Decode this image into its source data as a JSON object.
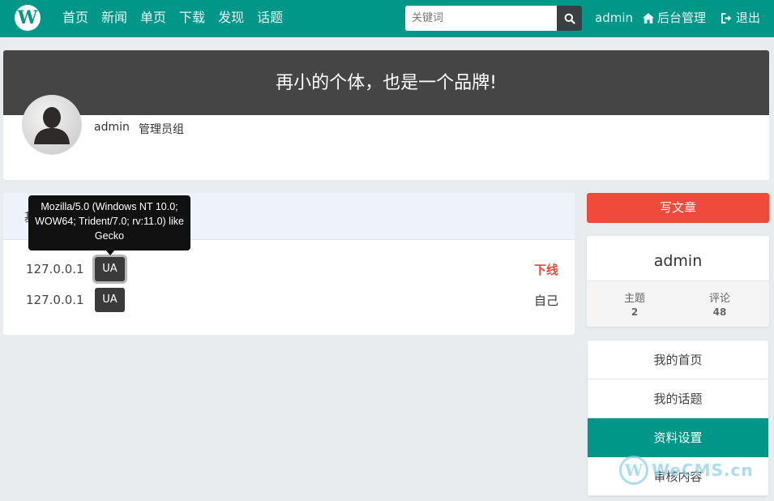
{
  "colors": {
    "brand": "#009688",
    "danger": "#f04a3a",
    "offline_text": "#e74c3c",
    "dark": "#454545"
  },
  "header": {
    "logo_letter": "W",
    "nav": [
      "首页",
      "新闻",
      "单页",
      "下载",
      "发现",
      "话题"
    ],
    "search": {
      "placeholder": "关键词",
      "icon": "search-icon"
    },
    "user": "admin",
    "admin_link": "后台管理",
    "logout": "退出"
  },
  "banner": {
    "slogan": "再小的个体，也是一个品牌!",
    "username": "admin",
    "group": "管理员组"
  },
  "sessions": {
    "title": "基本",
    "tooltip": "Mozilla/5.0 (Windows NT 10.0; WOW64; Trident/7.0; rv:11.0) like Gecko",
    "rows": [
      {
        "ip": "127.0.0.1",
        "ua_label": "UA",
        "action": "下线"
      },
      {
        "ip": "127.0.0.1",
        "ua_label": "UA",
        "action": "自己"
      }
    ]
  },
  "sidebar": {
    "write_button": "写文章",
    "card": {
      "name": "admin",
      "stats": [
        {
          "label": "主题",
          "value": "2"
        },
        {
          "label": "评论",
          "value": "48"
        }
      ]
    },
    "menu": [
      "我的首页",
      "我的话题",
      "资料设置",
      "审核内容"
    ],
    "active_menu_index": 2
  },
  "watermark": {
    "letter": "W",
    "text": "WeCMS.cn"
  }
}
